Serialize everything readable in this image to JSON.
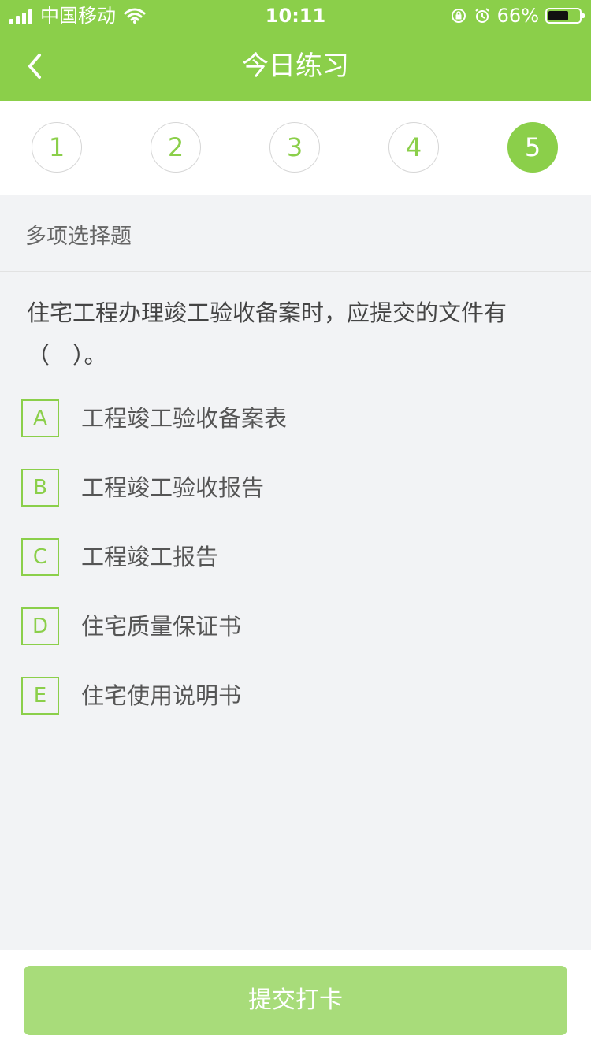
{
  "status_bar": {
    "carrier": "中国移动",
    "time": "10:11",
    "battery_percent": "66%",
    "battery_level": 0.66
  },
  "nav": {
    "title": "今日练习",
    "back_icon": "chevron-left-icon"
  },
  "steps": [
    {
      "label": "1",
      "active": false
    },
    {
      "label": "2",
      "active": false
    },
    {
      "label": "3",
      "active": false
    },
    {
      "label": "4",
      "active": false
    },
    {
      "label": "5",
      "active": true
    }
  ],
  "question": {
    "type": "多项选择题",
    "stem": "住宅工程办理竣工验收备案时，应提交的文件有（　）。",
    "options": [
      {
        "letter": "A",
        "text": "工程竣工验收备案表"
      },
      {
        "letter": "B",
        "text": "工程竣工验收报告"
      },
      {
        "letter": "C",
        "text": "工程竣工报告"
      },
      {
        "letter": "D",
        "text": "住宅质量保证书"
      },
      {
        "letter": "E",
        "text": "住宅使用说明书"
      }
    ]
  },
  "footer": {
    "submit_label": "提交打卡"
  },
  "colors": {
    "accent": "#8bcf4a",
    "button_disabled": "#a8dc7a",
    "background": "#f2f3f5"
  }
}
